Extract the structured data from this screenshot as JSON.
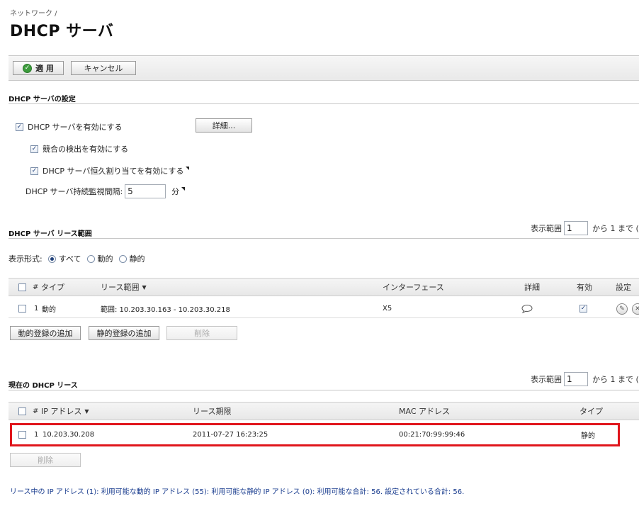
{
  "header": {
    "breadcrumb": "ネットワーク /",
    "title": "DHCP サーバ"
  },
  "toolbar": {
    "apply_label": "適 用",
    "cancel_label": "キャンセル"
  },
  "settings": {
    "title": "DHCP サーバの設定",
    "enable_server_label": "DHCP サーバを有効にする",
    "details_button": "詳細...",
    "conflict_detect_label": "競合の検出を有効にする",
    "persistent_label": "DHCP サーバ恒久割り当てを有効にする",
    "monitor_label": "DHCP サーバ持続監視間隔:",
    "monitor_value": "5",
    "monitor_unit": "分"
  },
  "lease_scope": {
    "title": "DHCP サーバ リース範囲",
    "pager_label": "表示範囲",
    "pager_value": "1",
    "pager_suffix": "から 1 まで (",
    "view_label": "表示形式:",
    "view_options": [
      "すべて",
      "動的",
      "静的"
    ],
    "view_selected": "すべて",
    "columns": {
      "num": "#",
      "type": "タイプ",
      "range": "リース範囲",
      "interface": "インターフェース",
      "details": "詳細",
      "enabled": "有効",
      "configure": "設定"
    },
    "rows": [
      {
        "num": "1",
        "type": "動的",
        "range": "範囲: 10.203.30.163 - 10.203.30.218",
        "interface": "X5",
        "enabled": true
      }
    ],
    "add_dynamic_button": "動的登録の追加",
    "add_static_button": "静的登録の追加",
    "delete_button": "削除"
  },
  "current_leases": {
    "title": "現在の DHCP リース",
    "pager_label": "表示範囲",
    "pager_value": "1",
    "pager_suffix": "から 1 まで (",
    "columns": {
      "num": "#",
      "ip": "IP アドレス",
      "expiry": "リース期限",
      "mac": "MAC アドレス",
      "type": "タイプ"
    },
    "rows": [
      {
        "num": "1",
        "ip": "10.203.30.208",
        "expiry": "2011-07-27 16:23:25",
        "mac": "00:21:70:99:99:46",
        "type": "静的"
      }
    ],
    "delete_button": "削除"
  },
  "footer": {
    "summary": "リース中の IP アドレス (1): 利用可能な動的 IP アドレス (55): 利用可能な静的 IP アドレス (0): 利用可能な合計: 56. 設定されている合計: 56."
  },
  "colors": {
    "highlight": "#e0161c",
    "apply_icon": "#3c9b3c",
    "footer_text": "#1a3d8f"
  }
}
